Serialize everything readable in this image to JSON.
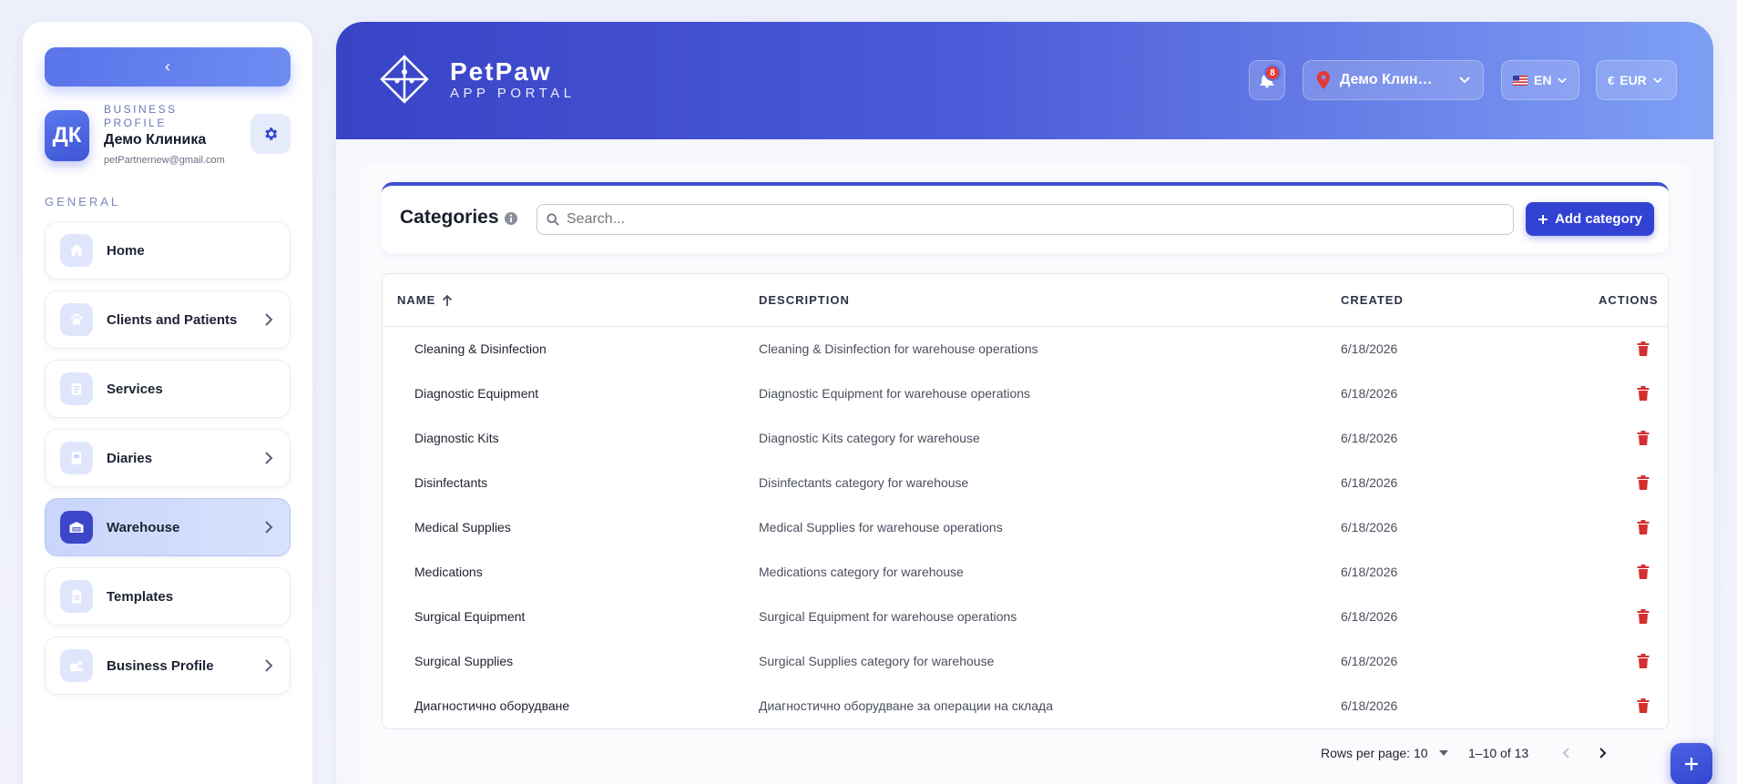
{
  "sidebar": {
    "collapse_label": "‹",
    "profile": {
      "kicker": "BUSINESS PROFILE",
      "name": "Демо Клиника",
      "email": "petPartnernew@gmail.com",
      "avatar_initials": "ДК"
    },
    "section_label": "GENERAL",
    "items": [
      {
        "label": "Home",
        "icon": "home-icon",
        "has_chevron": false,
        "active": false
      },
      {
        "label": "Clients and Patients",
        "icon": "paw-icon",
        "has_chevron": true,
        "active": false
      },
      {
        "label": "Services",
        "icon": "clipboard-icon",
        "has_chevron": false,
        "active": false
      },
      {
        "label": "Diaries",
        "icon": "book-icon",
        "has_chevron": true,
        "active": false
      },
      {
        "label": "Warehouse",
        "icon": "warehouse-icon",
        "has_chevron": true,
        "active": true
      },
      {
        "label": "Templates",
        "icon": "document-icon",
        "has_chevron": false,
        "active": false
      },
      {
        "label": "Business Profile",
        "icon": "business-icon",
        "has_chevron": true,
        "active": false
      }
    ]
  },
  "header": {
    "brand_name": "PetPaw",
    "brand_sub": "APP PORTAL",
    "notifications_count": "8",
    "clinic": "Демо Клин…",
    "language": "EN",
    "currency": "EUR"
  },
  "toolbar": {
    "title": "Categories",
    "search_placeholder": "Search...",
    "add_label": "Add category"
  },
  "table": {
    "columns": [
      "NAME",
      "DESCRIPTION",
      "CREATED",
      "ACTIONS"
    ],
    "rows": [
      {
        "name": "Cleaning & Disinfection",
        "description": "Cleaning & Disinfection for warehouse operations",
        "created": "6/18/2026"
      },
      {
        "name": "Diagnostic Equipment",
        "description": "Diagnostic Equipment for warehouse operations",
        "created": "6/18/2026"
      },
      {
        "name": "Diagnostic Kits",
        "description": "Diagnostic Kits category for warehouse",
        "created": "6/18/2026"
      },
      {
        "name": "Disinfectants",
        "description": "Disinfectants category for warehouse",
        "created": "6/18/2026"
      },
      {
        "name": "Medical Supplies",
        "description": "Medical Supplies for warehouse operations",
        "created": "6/18/2026"
      },
      {
        "name": "Medications",
        "description": "Medications category for warehouse",
        "created": "6/18/2026"
      },
      {
        "name": "Surgical Equipment",
        "description": "Surgical Equipment for warehouse operations",
        "created": "6/18/2026"
      },
      {
        "name": "Surgical Supplies",
        "description": "Surgical Supplies category for warehouse",
        "created": "6/18/2026"
      },
      {
        "name": "Диагностично оборудване",
        "description": "Диагностично оборудване за операции на склада",
        "created": "6/18/2026"
      }
    ]
  },
  "pagination": {
    "rows_per_page_label": "Rows per page:",
    "rows_per_page_value": "10",
    "range": "1–10 of 13"
  },
  "colors": {
    "accent": "#3242d3",
    "delete": "#d32f2f",
    "header_start": "#3844c6",
    "header_end": "#7f9ff5"
  }
}
